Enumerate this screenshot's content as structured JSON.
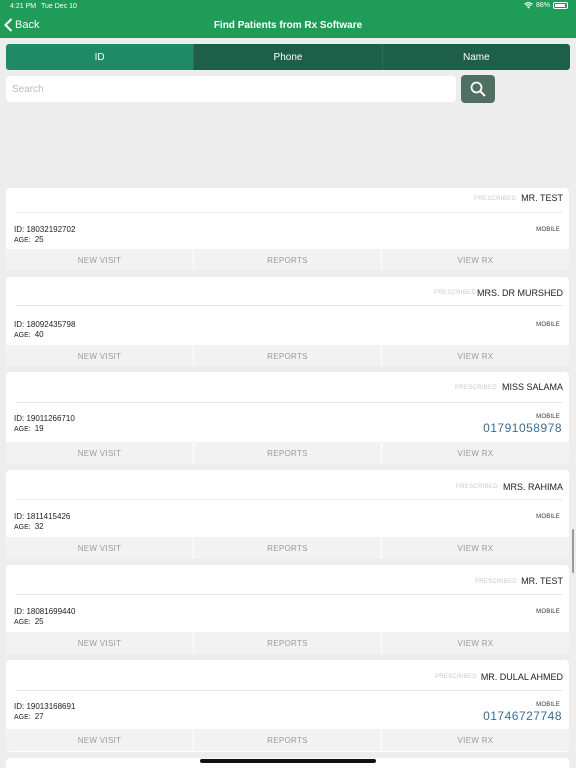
{
  "status": {
    "time": "4:21 PM",
    "date": "Tue Dec 10",
    "battery": "88%"
  },
  "nav": {
    "back_label": "Back",
    "title": "Find Patients from Rx Software"
  },
  "tabs": [
    {
      "label": "ID",
      "active": true
    },
    {
      "label": "Phone",
      "active": false
    },
    {
      "label": "Name",
      "active": false
    }
  ],
  "search": {
    "placeholder": "Search",
    "value": ""
  },
  "prescribed_label": "PRESCRIBED",
  "mobile_label": "MOBILE",
  "age_label": "AGE:",
  "actions": {
    "new_visit": "NEW VISIT",
    "reports": "REPORTS",
    "view_rx": "VIEW RX"
  },
  "patients": [
    {
      "name": "MR. TEST",
      "id": "ID: 18032192702",
      "age": "25",
      "mobile": ""
    },
    {
      "name": "MRS. DR MURSHED",
      "id": "ID: 18092435798",
      "age": "40",
      "mobile": ""
    },
    {
      "name": "MISS SALAMA",
      "id": "ID: 19011266710",
      "age": "19",
      "mobile": "01791058978"
    },
    {
      "name": "MRS. RAHIMA",
      "id": "ID: 1811415426",
      "age": "32",
      "mobile": ""
    },
    {
      "name": "MR. TEST",
      "id": "ID: 18081699440",
      "age": "25",
      "mobile": ""
    },
    {
      "name": "MR. DULAL AHMED",
      "id": "ID: 19013168691",
      "age": "27",
      "mobile": "01746727748"
    }
  ],
  "colors": {
    "header": "#1f9d58",
    "tab_active": "#1f8a66",
    "tab_inactive": "#1e5f49",
    "phone": "#3a6d95"
  }
}
